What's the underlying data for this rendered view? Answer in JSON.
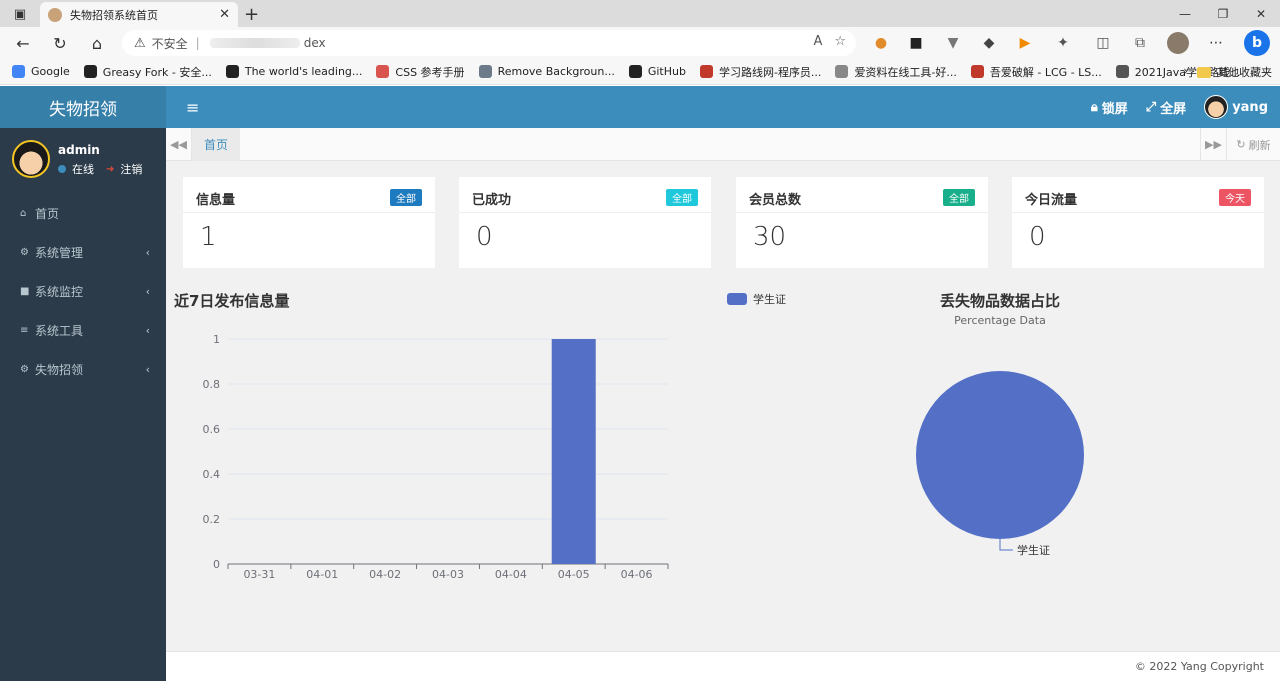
{
  "browser": {
    "tab_title": "失物招领系统首页",
    "insecure_label": "不安全",
    "url_fragment": "dex",
    "bookmarks": [
      "Google",
      "Greasy Fork - 安全...",
      "The world's leading...",
      "CSS 参考手册",
      "Remove Backgroun...",
      "GitHub",
      "学习路线网-程序员...",
      "爱资料在线工具-好...",
      "吾爱破解 - LCG - LS...",
      "2021Java学习路线..."
    ],
    "bookmark_folder": "其他收藏夹",
    "bookmark_colors": [
      "#4285f4",
      "#222222",
      "#222222",
      "#d9534f",
      "#6c7a89",
      "#222222",
      "#c0392b",
      "#888888",
      "#c0392b",
      "#555555"
    ]
  },
  "app": {
    "logo": "失物招领",
    "lock_label": "锁屏",
    "fullscreen_label": "全屏",
    "username": "yang"
  },
  "sidebar": {
    "user": "admin",
    "status": "在线",
    "logout": "注销",
    "items": [
      {
        "label": "首页",
        "icon": "home-icon",
        "glyph": "⌂",
        "has_children": false
      },
      {
        "label": "系统管理",
        "icon": "gear-icon",
        "glyph": "⚙",
        "has_children": true
      },
      {
        "label": "系统监控",
        "icon": "video-camera-icon",
        "glyph": "■",
        "has_children": true
      },
      {
        "label": "系统工具",
        "icon": "bars-icon",
        "glyph": "≡",
        "has_children": true
      },
      {
        "label": "失物招领",
        "icon": "gears-icon",
        "glyph": "⚙",
        "has_children": true
      }
    ]
  },
  "tabs": {
    "home": "首页",
    "refresh": "刷新"
  },
  "cards": [
    {
      "title": "信息量",
      "badge": "全部",
      "badge_color": "#1f7bbf",
      "value": "1"
    },
    {
      "title": "已成功",
      "badge": "全部",
      "badge_color": "#1fc8db",
      "value": "0"
    },
    {
      "title": "会员总数",
      "badge": "全部",
      "badge_color": "#1aaf8b",
      "value": "30"
    },
    {
      "title": "今日流量",
      "badge": "今天",
      "badge_color": "#ed5565",
      "value": "0"
    }
  ],
  "chart_data": [
    {
      "type": "bar",
      "title": "近7日发布信息量",
      "categories": [
        "03-31",
        "04-01",
        "04-02",
        "04-03",
        "04-04",
        "04-05",
        "04-06"
      ],
      "series": [
        {
          "name": "学生证",
          "values": [
            0,
            0,
            0,
            0,
            0,
            1,
            0
          ],
          "color": "#5470c6"
        }
      ],
      "ylim": [
        0,
        1
      ],
      "yticks": [
        "0",
        "0.2",
        "0.4",
        "0.6",
        "0.8",
        "1"
      ],
      "grid": true,
      "legend": "top"
    },
    {
      "type": "pie",
      "title": "丢失物品数据占比",
      "subtitle": "Percentage Data",
      "slices": [
        {
          "label": "学生证",
          "value": 1,
          "color": "#5470c6"
        }
      ]
    }
  ],
  "footer": {
    "copyright": "© 2022 Yang Copyright"
  }
}
